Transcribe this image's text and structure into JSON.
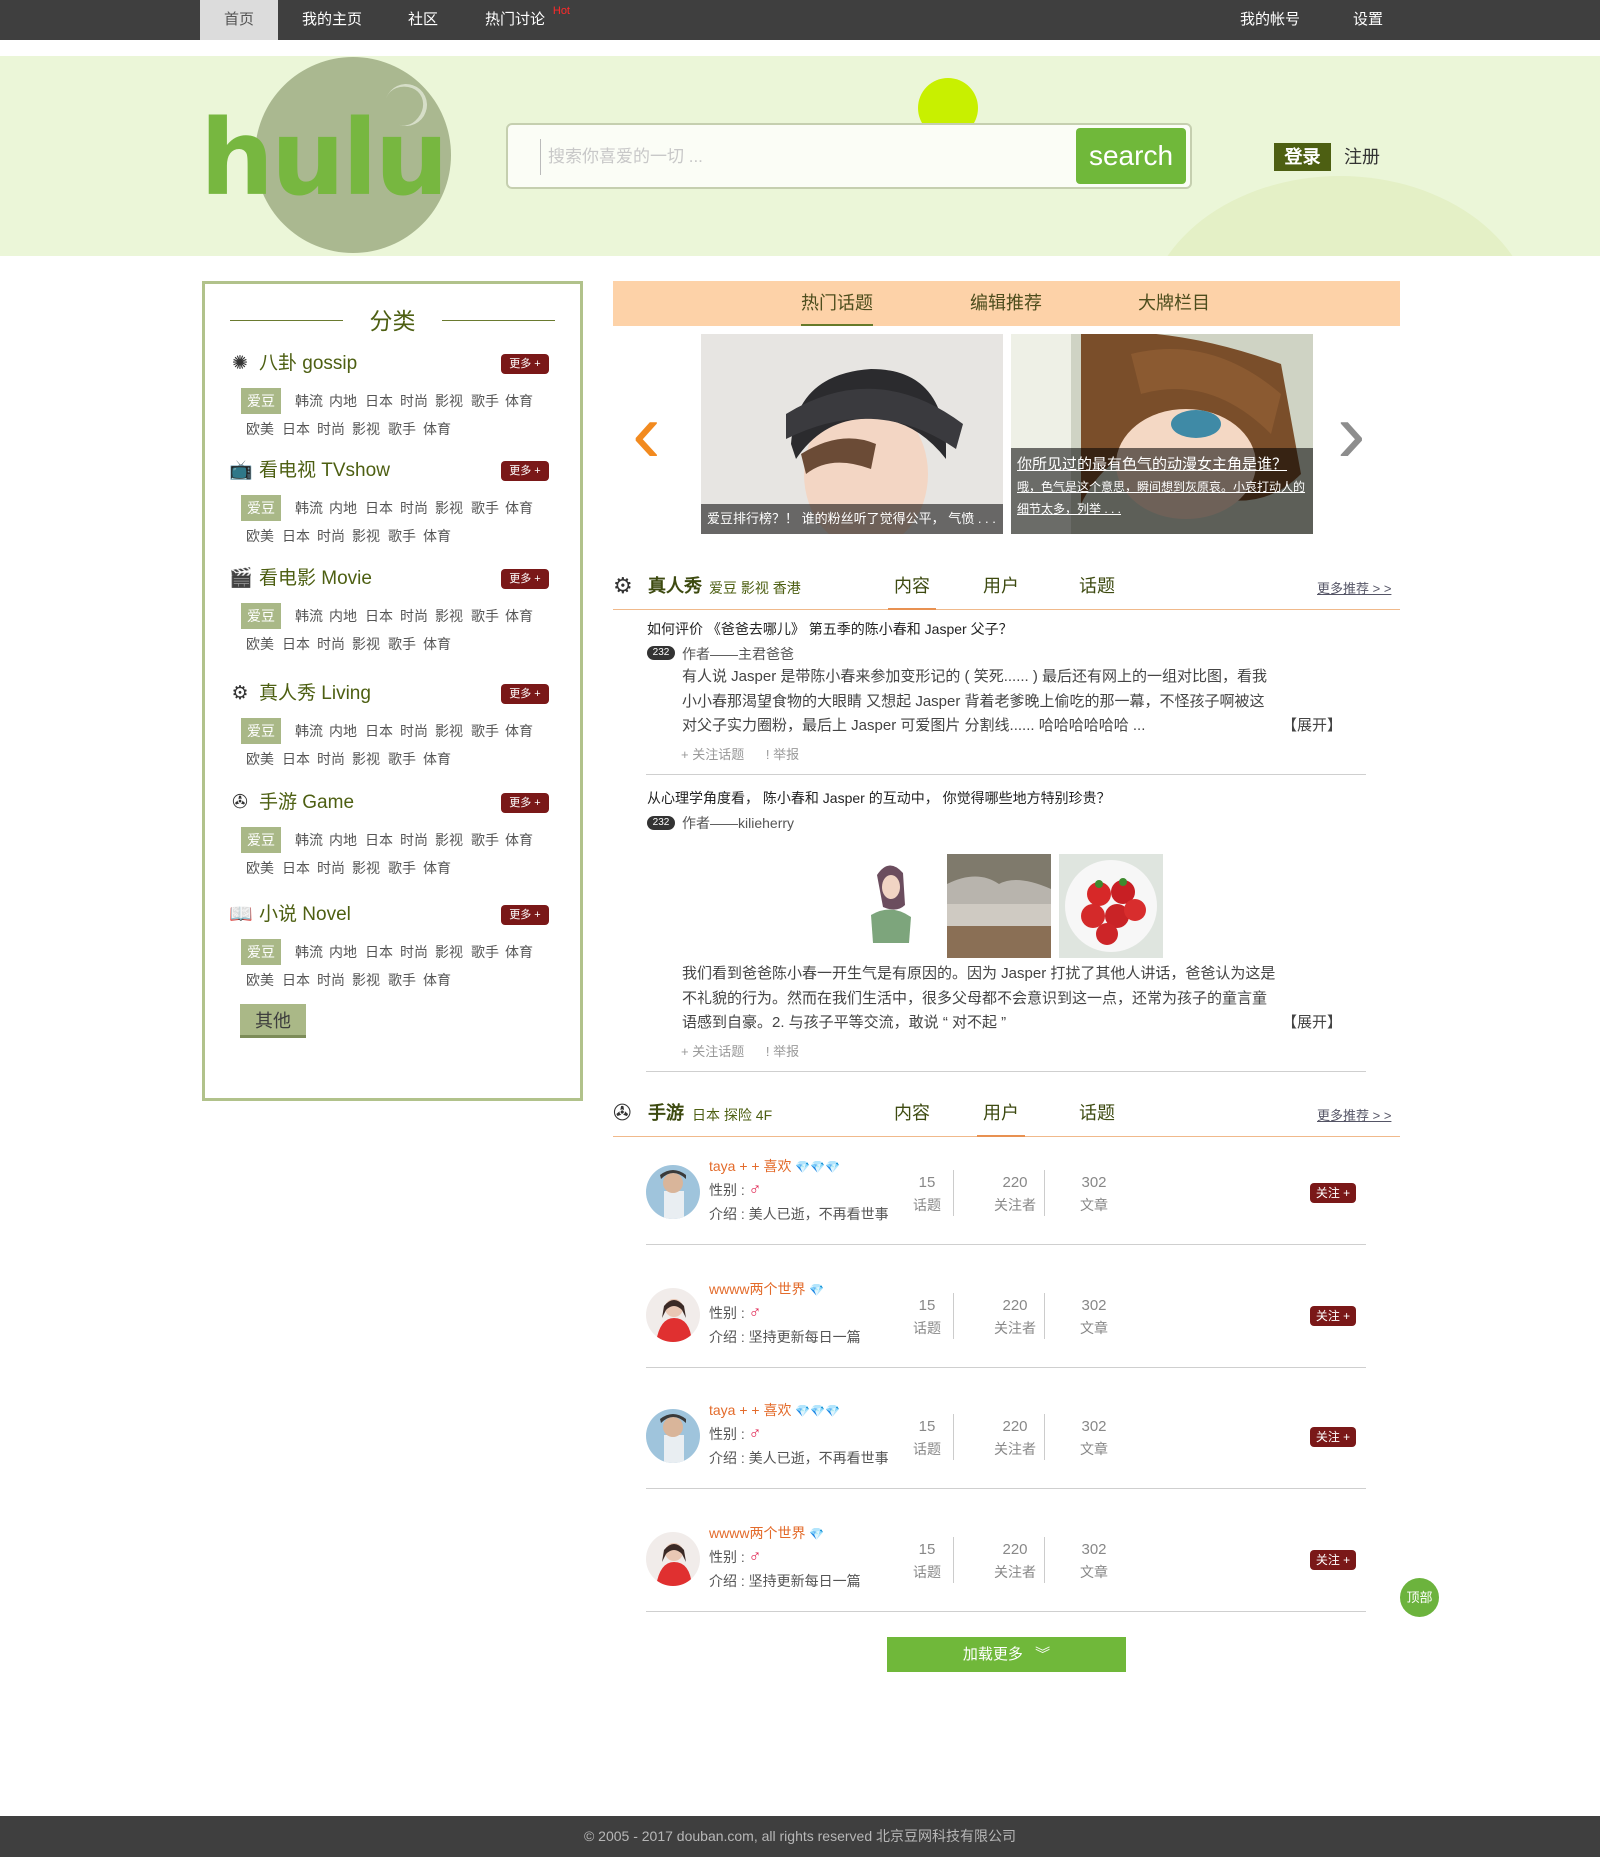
{
  "topnav": {
    "items": [
      "首页",
      "我的主页",
      "社区",
      "热门讨论"
    ],
    "hot_badge": "Hot",
    "right": [
      "我的帐号",
      "设置"
    ]
  },
  "header": {
    "logo_text": "hulu",
    "search_placeholder": "搜索你喜爱的一切 ...",
    "search_button": "search",
    "login": "登录",
    "register": "注册"
  },
  "sidebar": {
    "title": "分类",
    "more_label": "更多 +",
    "other_button": "其他",
    "categories": [
      {
        "icon": "spinner-icon",
        "name": "八卦 gossip",
        "row1": [
          "爱豆",
          "韩流",
          "内地",
          "日本",
          "时尚",
          "影视",
          "歌手",
          "体育"
        ],
        "row2": [
          "欧美",
          "日本",
          "时尚",
          "影视",
          "歌手",
          "体育"
        ]
      },
      {
        "icon": "tv-icon",
        "name": "看电视 TVshow",
        "row1": [
          "爱豆",
          "韩流",
          "内地",
          "日本",
          "时尚",
          "影视",
          "歌手",
          "体育"
        ],
        "row2": [
          "欧美",
          "日本",
          "时尚",
          "影视",
          "歌手",
          "体育"
        ]
      },
      {
        "icon": "clapperboard-icon",
        "name": "看电影 Movie",
        "row1": [
          "爱豆",
          "韩流",
          "内地",
          "日本",
          "时尚",
          "影视",
          "歌手",
          "体育"
        ],
        "row2": [
          "欧美",
          "日本",
          "时尚",
          "影视",
          "歌手",
          "体育"
        ]
      },
      {
        "icon": "film-reel-icon",
        "name": "真人秀 Living",
        "row1": [
          "爱豆",
          "韩流",
          "内地",
          "日本",
          "时尚",
          "影视",
          "歌手",
          "体育"
        ],
        "row2": [
          "欧美",
          "日本",
          "时尚",
          "影视",
          "歌手",
          "体育"
        ]
      },
      {
        "icon": "gamepad-icon",
        "name": "手游 Game",
        "row1": [
          "爱豆",
          "韩流",
          "内地",
          "日本",
          "时尚",
          "影视",
          "歌手",
          "体育"
        ],
        "row2": [
          "欧美",
          "日本",
          "时尚",
          "影视",
          "歌手",
          "体育"
        ]
      },
      {
        "icon": "book-icon",
        "name": "小说 Novel",
        "row1": [
          "爱豆",
          "韩流",
          "内地",
          "日本",
          "时尚",
          "影视",
          "歌手",
          "体育"
        ],
        "row2": [
          "欧美",
          "日本",
          "时尚",
          "影视",
          "歌手",
          "体育"
        ]
      }
    ]
  },
  "tabs": [
    "热门话题",
    "编辑推荐",
    "大牌栏目"
  ],
  "carousel": {
    "slide1_caption": "爱豆排行榜？！ 谁的粉丝听了觉得公平， 气愤 . . .",
    "slide2_title": "你所见过的最有色气的动漫女主角是谁？",
    "slide2_desc": "哦，色气是这个意思，瞬间想到灰原哀。小哀打动人的细节太多，列举 . . ."
  },
  "reality": {
    "title": "真人秀",
    "subtitle": "爱豆 影视 香港",
    "tabs": [
      "内容",
      "用户",
      "话题"
    ],
    "more": "更多推荐 > >",
    "posts": [
      {
        "title": "如何评价 《爸爸去哪儿》 第五季的陈小春和 Jasper 父子？",
        "count": "232",
        "author": "作者——主君爸爸",
        "lines": [
          "有人说 Jasper 是带陈小春来参加变形记的 ( 笑死...... ) 最后还有网上的一组对比图，看我",
          "小小春那渴望食物的大眼睛 又想起 Jasper 背着老爹晚上偷吃的那一幕，不怪孩子啊被这",
          "对父子实力圈粉，最后上 Jasper 可爱图片 分割线...... 哈哈哈哈哈哈 ..."
        ],
        "expand": "【展开】",
        "follow": "+ 关注话题",
        "report": "! 举报"
      },
      {
        "title": "从心理学角度看， 陈小春和 Jasper 的互动中， 你觉得哪些地方特别珍贵？",
        "count": "232",
        "author": "作者——kilieherry",
        "lines": [
          "我们看到爸爸陈小春一开生气是有原因的。因为 Jasper 打扰了其他人讲话，爸爸认为这是",
          "不礼貌的行为。然而在我们生活中，很多父母都不会意识到这一点，还常为孩子的童言童",
          "语感到自豪。2. 与孩子平等交流，敢说 “ 对不起 ”"
        ],
        "expand": "【展开】",
        "follow": "+ 关注话题",
        "report": "! 举报"
      }
    ]
  },
  "game": {
    "title": "手游",
    "subtitle": "日本 探险 4F",
    "tabs": [
      "内容",
      "用户",
      "话题"
    ],
    "more": "更多推荐 > >",
    "gender_label": "性别 :",
    "male_symbol": "♂",
    "follow": "关注 +",
    "stat_labels": [
      "话题",
      "关注者",
      "文章"
    ],
    "users": [
      {
        "name": "taya + + 喜欢",
        "gems": "💎💎💎",
        "intro": "介绍 : 美人已逝，不再看世事",
        "stats": [
          "15",
          "220",
          "302"
        ],
        "avatar": "boy-avatar"
      },
      {
        "name": "wwww两个世界",
        "gems": "💎",
        "intro": "介绍 : 坚持更新每日一篇",
        "stats": [
          "15",
          "220",
          "302"
        ],
        "avatar": "girl-avatar"
      },
      {
        "name": "taya + + 喜欢",
        "gems": "💎💎💎",
        "intro": "介绍 : 美人已逝，不再看世事",
        "stats": [
          "15",
          "220",
          "302"
        ],
        "avatar": "boy-avatar"
      },
      {
        "name": "wwww两个世界",
        "gems": "💎",
        "intro": "介绍 : 坚持更新每日一篇",
        "stats": [
          "15",
          "220",
          "302"
        ],
        "avatar": "girl-avatar"
      }
    ]
  },
  "load_more": "加载更多",
  "to_top": "顶部",
  "footer": "© 2005 - 2017 douban.com, all rights reserved 北京豆网科技有限公司"
}
